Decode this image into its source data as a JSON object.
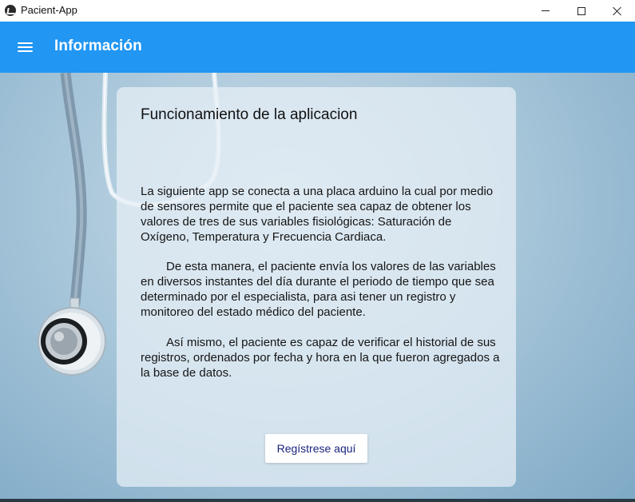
{
  "window": {
    "title": "Pacient-App",
    "icon": "app-icon"
  },
  "appbar": {
    "title": "Información",
    "menu_icon": "hamburger-menu-icon",
    "color": "#2196f3"
  },
  "card": {
    "title": "Funcionamiento de la aplicacion",
    "paragraphs": [
      "La siguiente app se conecta a una placa arduino la cual por medio de sensores permite que el paciente sea capaz de obtener los valores de tres de sus variables fisiológicas: Saturación de Oxígeno, Temperatura y Frecuencia Cardiaca.",
      "De esta manera, el paciente envía los valores de las variables en diversos instantes del día durante el periodo de tiempo que sea determinado por el especialista, para asi tener un registro y monitoreo del estado médico del paciente.",
      "Así mismo, el paciente es capaz de verificar el historial de sus registros, ordenados por fecha y hora en la que fueron agregados a la base de datos."
    ],
    "register_button": "Regístrese aquí"
  },
  "background": {
    "image": "stethoscope-background"
  }
}
